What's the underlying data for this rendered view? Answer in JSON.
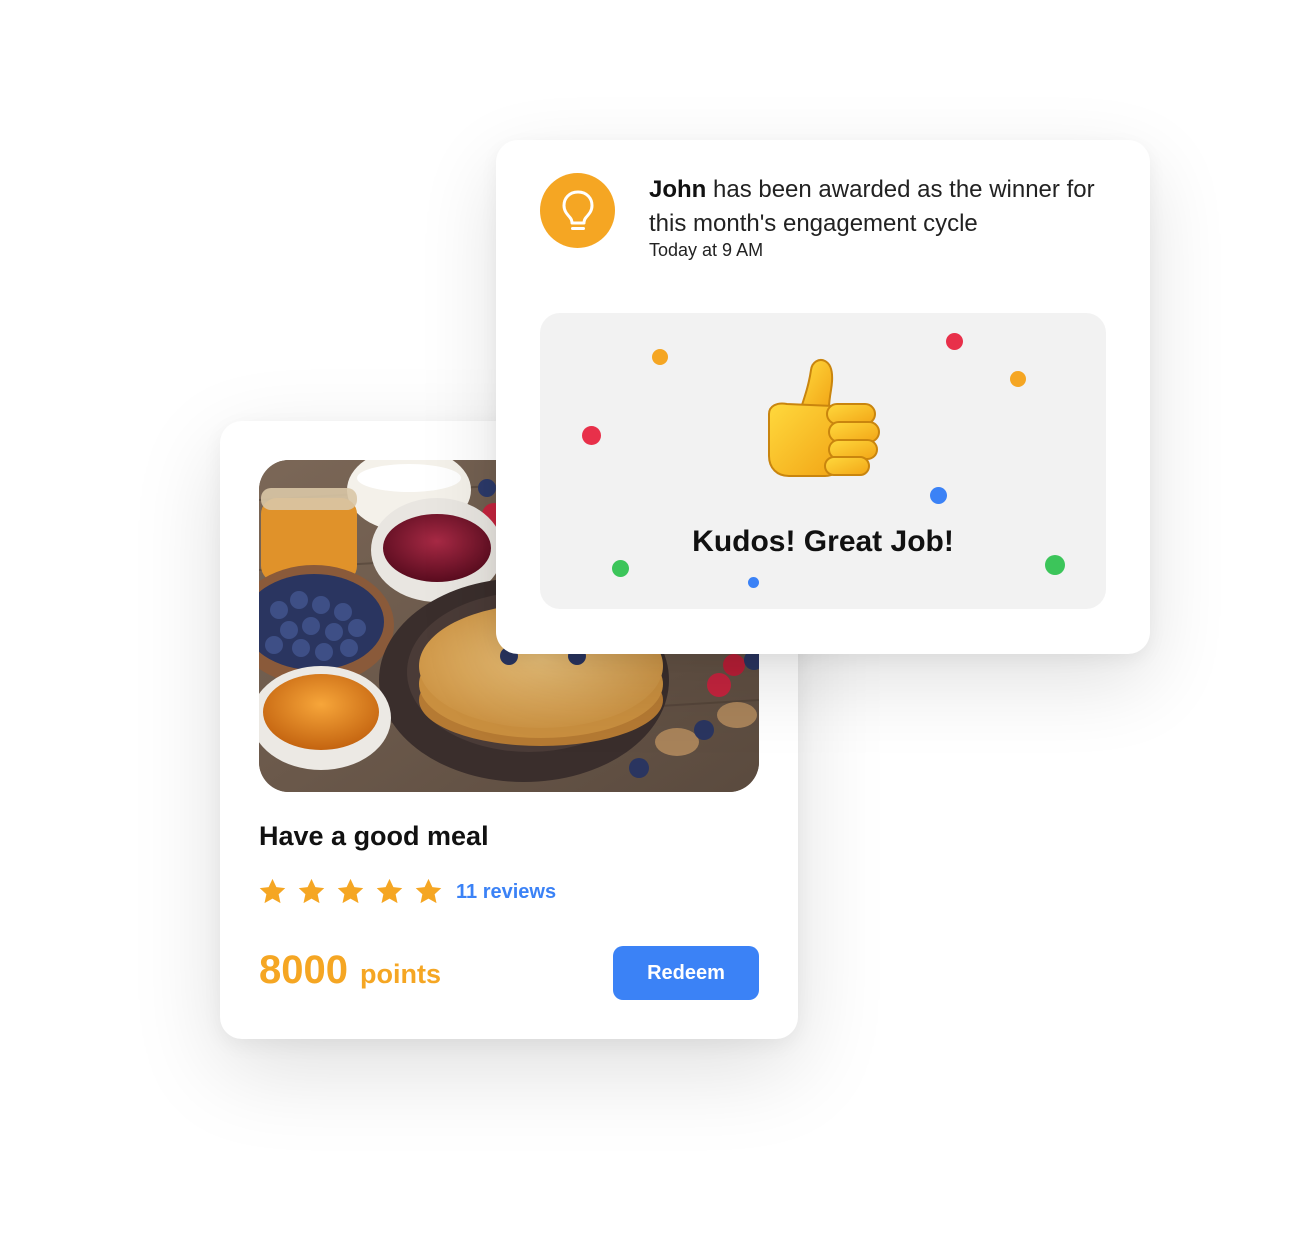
{
  "reward_card": {
    "title": "Have a good meal",
    "rating": 5,
    "rating_max": 5,
    "reviews_label": "11 reviews",
    "points_value": "8000",
    "points_unit": "points",
    "redeem_label": "Redeem",
    "image_subject": "pancakes-breakfast-photo"
  },
  "notification": {
    "icon": "lightbulb-icon",
    "name": "John",
    "message": " has been awarded as the winner for this month's engagement cycle",
    "time": "Today at 9 AM",
    "kudos_emoji": "thumbs-up-icon",
    "kudos_text": "Kudos! Great Job!"
  },
  "colors": {
    "accent_orange": "#f5a623",
    "accent_blue": "#3b82f6",
    "confetti_red": "#e8304a",
    "confetti_green": "#3cc55a",
    "panel_gray": "#f2f2f2"
  }
}
